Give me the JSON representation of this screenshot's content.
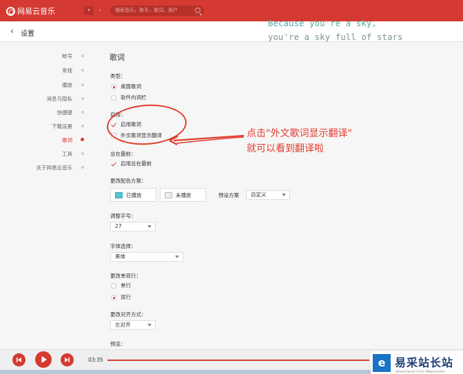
{
  "header": {
    "app_name": "网易云音乐",
    "back_arrow": "‹",
    "forward_arrow": "›",
    "search_placeholder": "搜索音乐，歌手，歌词，用户"
  },
  "subbar": {
    "back_label": "‹",
    "title": "设置"
  },
  "overlay_lyrics": [
    "Because you're a sky,",
    "you're a sky full of stars"
  ],
  "sidebar": {
    "items": [
      {
        "label": "帐号"
      },
      {
        "label": "常规"
      },
      {
        "label": "播放"
      },
      {
        "label": "消息与隐私"
      },
      {
        "label": "快捷键"
      },
      {
        "label": "下载设置"
      },
      {
        "label": "歌词"
      },
      {
        "label": "工具"
      },
      {
        "label": "关于网易云音乐"
      }
    ],
    "active_index": 6
  },
  "main": {
    "section_title": "歌词",
    "type_label": "类型：",
    "type_options": [
      "桌面歌词",
      "软件内词栏"
    ],
    "type_selected": 0,
    "enable_label": "启用：",
    "enable_options": [
      {
        "label": "启用歌词",
        "checked": true
      },
      {
        "label": "外文歌词显示翻译",
        "checked": false
      }
    ],
    "ontop_label": "总在最前：",
    "ontop_option": {
      "label": "启用总在最前",
      "checked": true
    },
    "color_label": "更改配色方案：",
    "played_label": "已播放",
    "unplayed_label": "未播放",
    "preset_label": "预设方案",
    "preset_value": "自定义",
    "font_size_label": "调整字号：",
    "font_size_value": "27",
    "font_family_label": "字体选择：",
    "font_family_value": "黑体",
    "lines_label": "更改单双行：",
    "lines_options": [
      "单行",
      "双行"
    ],
    "lines_selected": 1,
    "align_label": "更改对齐方式：",
    "align_value": "左对齐",
    "preview_label": "预览："
  },
  "annotation": {
    "line1": "点击\"外文歌词显示翻译\"",
    "line2": "就可以看到翻译啦"
  },
  "player": {
    "time": "03:35"
  },
  "watermark": {
    "logo_glyph": "e",
    "text": "易采站长站",
    "sub": "Www.Easck.Com Webmaster"
  },
  "colors": {
    "brand_red": "#d43a31",
    "annotation_red": "#e23b2e",
    "played_swatch": "#54c3d6",
    "unplayed_swatch": "#e8eef3"
  }
}
